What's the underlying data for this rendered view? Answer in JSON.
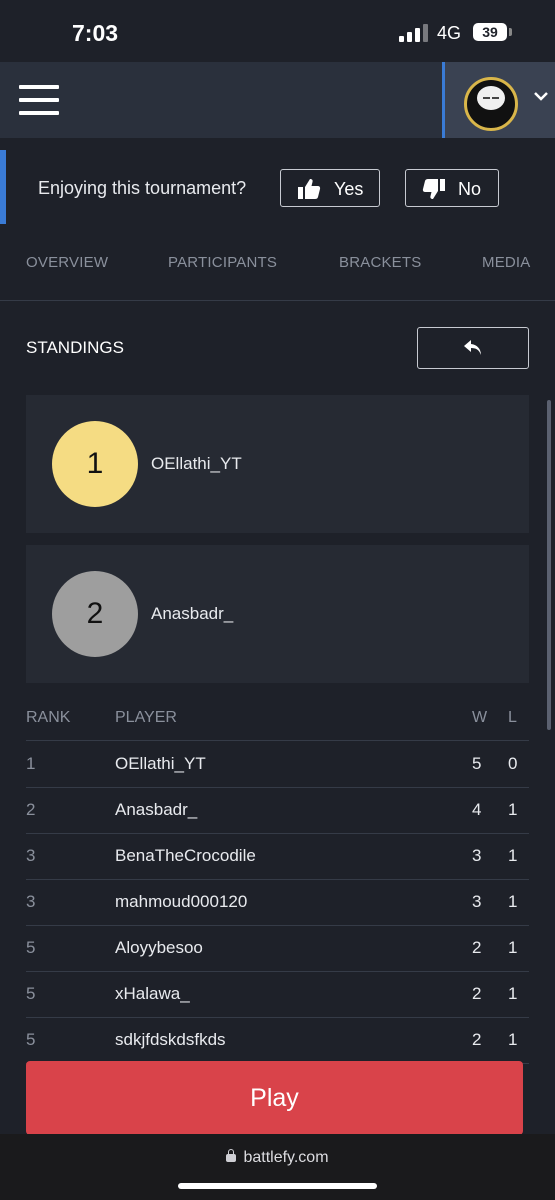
{
  "status_bar": {
    "time": "7:03",
    "network": "4G",
    "battery": "39"
  },
  "header": {
    "menu_icon": "hamburger-icon",
    "avatar_icon": "avatar",
    "chevron_icon": "chevron-down-icon"
  },
  "feedback": {
    "question": "Enjoying this tournament?",
    "yes_label": "Yes",
    "no_label": "No",
    "yes_icon": "thumbs-up-icon",
    "no_icon": "thumbs-down-icon"
  },
  "tabs": [
    {
      "label": "OVERVIEW"
    },
    {
      "label": "PARTICIPANTS"
    },
    {
      "label": "BRACKETS"
    },
    {
      "label": "MEDIA"
    }
  ],
  "standings": {
    "title": "STANDINGS",
    "back_icon": "reply-arrow-icon",
    "podium": [
      {
        "rank": "1",
        "name": "OEllathi_YT",
        "color": "#f5dc83"
      },
      {
        "rank": "2",
        "name": "Anasbadr_",
        "color": "#9e9e9e"
      }
    ],
    "columns": {
      "rank": "RANK",
      "player": "PLAYER",
      "w": "W",
      "l": "L"
    },
    "rows": [
      {
        "rank": "1",
        "player": "OEllathi_YT",
        "w": "5",
        "l": "0"
      },
      {
        "rank": "2",
        "player": "Anasbadr_",
        "w": "4",
        "l": "1"
      },
      {
        "rank": "3",
        "player": "BenaTheCrocodile",
        "w": "3",
        "l": "1"
      },
      {
        "rank": "3",
        "player": "mahmoud000120",
        "w": "3",
        "l": "1"
      },
      {
        "rank": "5",
        "player": "Aloyybesoo",
        "w": "2",
        "l": "1"
      },
      {
        "rank": "5",
        "player": "xHalawa_",
        "w": "2",
        "l": "1"
      },
      {
        "rank": "5",
        "player": "sdkjfdskdsfkds",
        "w": "2",
        "l": "1"
      }
    ]
  },
  "play_button": {
    "label": "Play",
    "color": "#d9434a"
  },
  "browser": {
    "url": "battlefy.com"
  }
}
